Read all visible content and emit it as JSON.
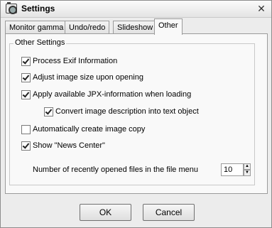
{
  "window": {
    "title": "Settings",
    "close_glyph": "✕"
  },
  "tabs": [
    {
      "label": "Monitor gamma"
    },
    {
      "label": "Undo/redo"
    },
    {
      "label": "Slideshow"
    },
    {
      "label": "Other",
      "active": true
    }
  ],
  "group": {
    "legend": "Other Settings",
    "options": [
      {
        "label": "Process Exif Information",
        "checked": true
      },
      {
        "label": "Adjust image size upon opening",
        "checked": true
      },
      {
        "label": "Apply available JPX-information when loading",
        "checked": true
      },
      {
        "label": "Convert image description into text object",
        "checked": true
      },
      {
        "label": "Automatically create image copy",
        "checked": false
      },
      {
        "label": "Show \"News Center\"",
        "checked": true
      }
    ]
  },
  "recent_files": {
    "label": "Number of recently opened files in the file menu",
    "value": "10",
    "up": "▲",
    "down": "▼"
  },
  "buttons": {
    "ok": "OK",
    "cancel": "Cancel"
  }
}
